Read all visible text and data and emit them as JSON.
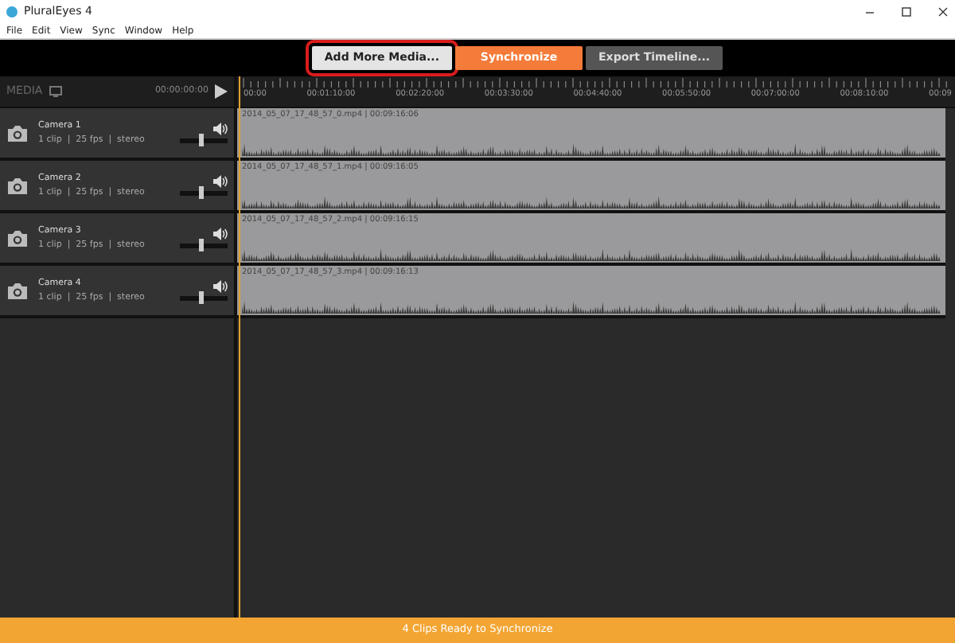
{
  "window": {
    "title": "PluralEyes 4"
  },
  "menu": [
    "File",
    "Edit",
    "View",
    "Sync",
    "Window",
    "Help"
  ],
  "toolbar": {
    "buttons": [
      {
        "label": "Add More Media...",
        "kind": "light",
        "highlighted": true
      },
      {
        "label": "Synchronize",
        "kind": "accent",
        "highlighted": false
      },
      {
        "label": "Export Timeline...",
        "kind": "dim",
        "highlighted": false
      }
    ]
  },
  "media_header": {
    "label": "MEDIA",
    "timecode": "00:00:00:00"
  },
  "ruler": {
    "labels": [
      "00:00",
      "00:01:10:00",
      "00:02:20:00",
      "00:03:30:00",
      "00:04:40:00",
      "00:05:50:00",
      "00:07:00:00",
      "00:08:10:00",
      "00:09"
    ]
  },
  "tracks": [
    {
      "name": "Camera 1",
      "details": "1 clip  |  25 fps  |  stereo",
      "level": 0.45,
      "clip_label": "2014_05_07_17_48_57_0.mp4 | 00:09:16:06"
    },
    {
      "name": "Camera 2",
      "details": "1 clip  |  25 fps  |  stereo",
      "level": 0.45,
      "clip_label": "2014_05_07_17_48_57_1.mp4 | 00:09:16:05"
    },
    {
      "name": "Camera 3",
      "details": "1 clip  |  25 fps  |  stereo",
      "level": 0.45,
      "clip_label": "2014_05_07_17_48_57_2.mp4 | 00:09:16:15"
    },
    {
      "name": "Camera 4",
      "details": "1 clip  |  25 fps  |  stereo",
      "level": 0.45,
      "clip_label": "2014_05_07_17_48_57_3.mp4 | 00:09:16:13"
    }
  ],
  "status_bar": "4 Clips Ready to Synchronize"
}
